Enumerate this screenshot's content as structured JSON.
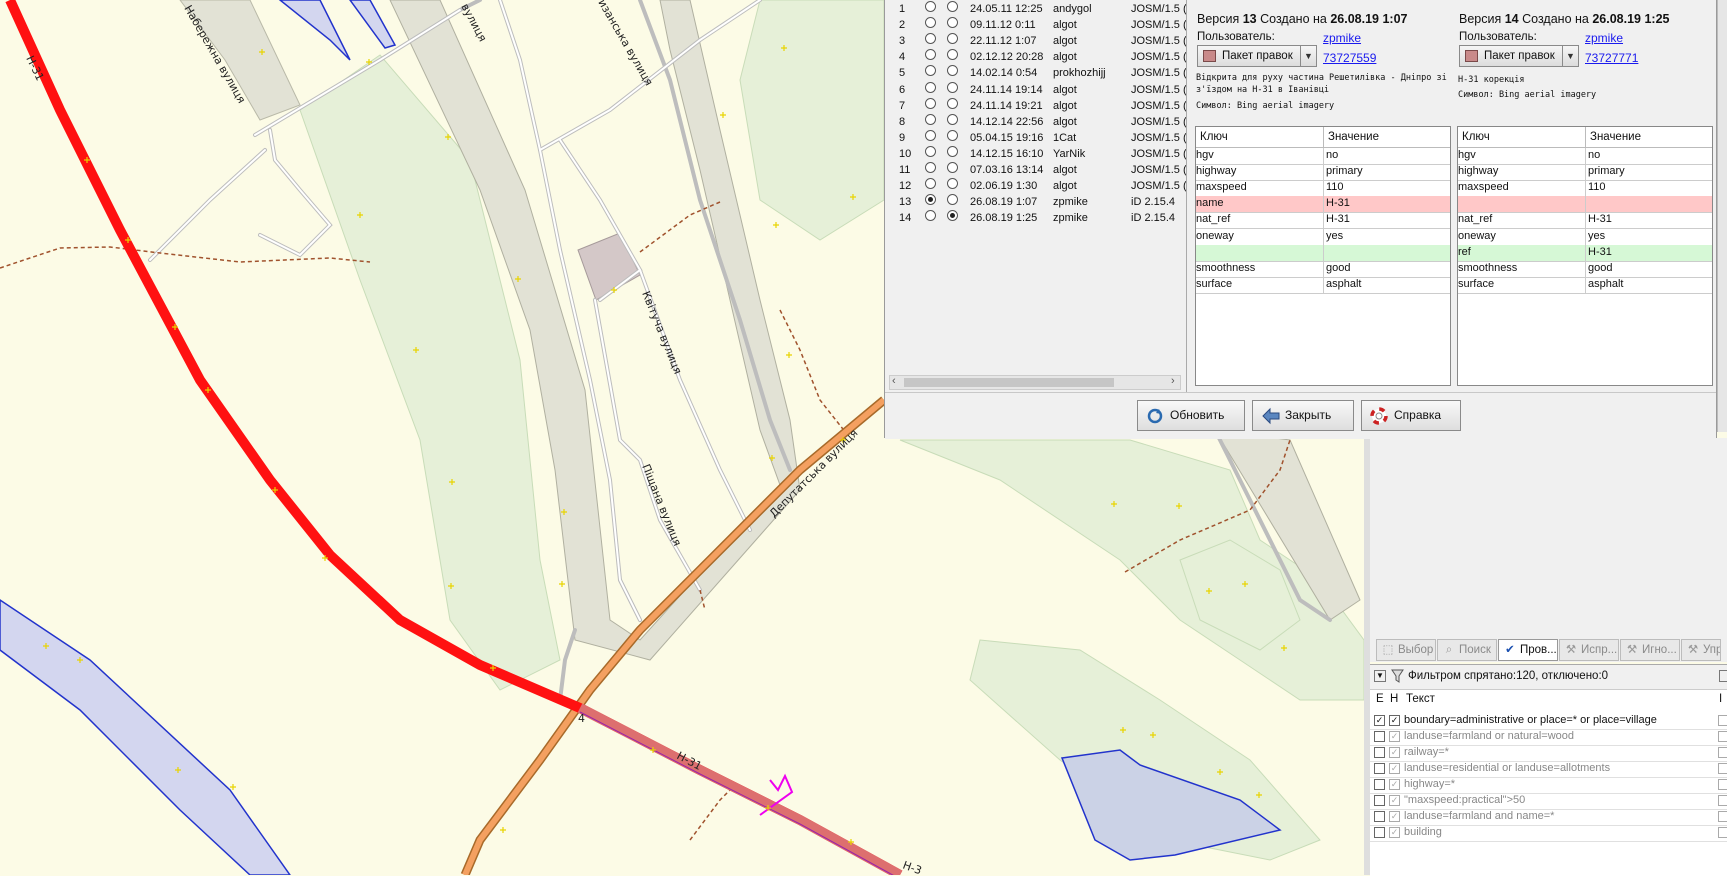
{
  "map": {
    "labels": {
      "street_embankment": "Набережна вулиця",
      "street_top": "вулиця",
      "street_vyzanska": "изанська вулиця",
      "street_kvitucha": "Квітуча вулиця",
      "street_pishchana": "Піщана вулиця",
      "street_deputatska": "Депутатська вулиця",
      "route_h31_a": "Н-31",
      "route_h31_b": "Н-31",
      "route_h31_c": "Н-3",
      "route_4": "4"
    }
  },
  "history": {
    "versions": [
      {
        "num": "1",
        "date": "24.05.11 12:25",
        "user": "andygol",
        "editor": "JOSM/1.5 (",
        "selA": false,
        "selB": false
      },
      {
        "num": "2",
        "date": "09.11.12 0:11",
        "user": "algot",
        "editor": "JOSM/1.5 (",
        "selA": false,
        "selB": false
      },
      {
        "num": "3",
        "date": "22.11.12 1:07",
        "user": "algot",
        "editor": "JOSM/1.5 (",
        "selA": false,
        "selB": false
      },
      {
        "num": "4",
        "date": "02.12.12 20:28",
        "user": "algot",
        "editor": "JOSM/1.5 (",
        "selA": false,
        "selB": false
      },
      {
        "num": "5",
        "date": "14.02.14 0:54",
        "user": "prokhozhijj",
        "editor": "JOSM/1.5 (",
        "selA": false,
        "selB": false
      },
      {
        "num": "6",
        "date": "24.11.14 19:14",
        "user": "algot",
        "editor": "JOSM/1.5 (",
        "selA": false,
        "selB": false
      },
      {
        "num": "7",
        "date": "24.11.14 19:21",
        "user": "algot",
        "editor": "JOSM/1.5 (",
        "selA": false,
        "selB": false
      },
      {
        "num": "8",
        "date": "14.12.14 22:56",
        "user": "algot",
        "editor": "JOSM/1.5 (",
        "selA": false,
        "selB": false
      },
      {
        "num": "9",
        "date": "05.04.15 19:16",
        "user": "1Cat",
        "editor": "JOSM/1.5 (",
        "selA": false,
        "selB": false
      },
      {
        "num": "10",
        "date": "14.12.15 16:10",
        "user": "YarNik",
        "editor": "JOSM/1.5 (",
        "selA": false,
        "selB": false
      },
      {
        "num": "11",
        "date": "07.03.16 13:14",
        "user": "algot",
        "editor": "JOSM/1.5 (",
        "selA": false,
        "selB": false
      },
      {
        "num": "12",
        "date": "02.06.19 1:30",
        "user": "algot",
        "editor": "JOSM/1.5 (",
        "selA": false,
        "selB": false
      },
      {
        "num": "13",
        "date": "26.08.19 1:07",
        "user": "zpmike",
        "editor": "iD 2.15.4",
        "selA": true,
        "selB": false
      },
      {
        "num": "14",
        "date": "26.08.19 1:25",
        "user": "zpmike",
        "editor": "iD 2.15.4",
        "selA": false,
        "selB": true
      }
    ],
    "left": {
      "title_prefix": "Версия",
      "version": "13",
      "created_label": "Создано на",
      "created": "26.08.19 1:07",
      "user_label": "Пользователь:",
      "user": "zpmike",
      "changeset_button": "Пакет правок",
      "changeset_id": "73727559",
      "comment": "Відкрита для руху частина Решетилівка - Дніпро зі з'їздом на Н-31 в Іванівці",
      "source": "Символ: Bing aerial imagery",
      "key_header": "Ключ",
      "value_header": "Значение",
      "tags": [
        {
          "key": "hgv",
          "value": "no",
          "state": ""
        },
        {
          "key": "highway",
          "value": "primary",
          "state": ""
        },
        {
          "key": "maxspeed",
          "value": "110",
          "state": ""
        },
        {
          "key": "name",
          "value": "Н-31",
          "state": "del"
        },
        {
          "key": "nat_ref",
          "value": "Н-31",
          "state": ""
        },
        {
          "key": "oneway",
          "value": "yes",
          "state": ""
        },
        {
          "key": "",
          "value": "",
          "state": "add"
        },
        {
          "key": "smoothness",
          "value": "good",
          "state": ""
        },
        {
          "key": "surface",
          "value": "asphalt",
          "state": ""
        }
      ]
    },
    "right": {
      "title_prefix": "Версия",
      "version": "14",
      "created_label": "Создано на",
      "created": "26.08.19 1:25",
      "user_label": "Пользователь:",
      "user": "zpmike",
      "changeset_button": "Пакет правок",
      "changeset_id": "73727771",
      "comment": "Н-31 корекція",
      "source": "Символ: Bing aerial imagery",
      "key_header": "Ключ",
      "value_header": "Значение",
      "tags": [
        {
          "key": "hgv",
          "value": "no",
          "state": ""
        },
        {
          "key": "highway",
          "value": "primary",
          "state": ""
        },
        {
          "key": "maxspeed",
          "value": "110",
          "state": ""
        },
        {
          "key": "",
          "value": "",
          "state": "del"
        },
        {
          "key": "nat_ref",
          "value": "Н-31",
          "state": ""
        },
        {
          "key": "oneway",
          "value": "yes",
          "state": ""
        },
        {
          "key": "ref",
          "value": "Н-31",
          "state": "add"
        },
        {
          "key": "smoothness",
          "value": "good",
          "state": ""
        },
        {
          "key": "surface",
          "value": "asphalt",
          "state": ""
        }
      ]
    },
    "buttons": {
      "refresh": "Обновить",
      "close": "Закрыть",
      "help": "Справка"
    }
  },
  "tabs": [
    {
      "label": "Выбор",
      "icon": "select-icon",
      "active": false
    },
    {
      "label": "Поиск",
      "icon": "search-icon",
      "active": false
    },
    {
      "label": "Пров...",
      "icon": "validation-check-icon",
      "active": true
    },
    {
      "label": "Испр...",
      "icon": "wrench-icon",
      "active": false
    },
    {
      "label": "Игно...",
      "icon": "wrench-icon",
      "active": false
    },
    {
      "label": "Упр",
      "icon": "wrench-icon",
      "active": false
    }
  ],
  "filter": {
    "status": "Фильтром спрятано:120, отключено:0",
    "col_e": "Е",
    "col_h": "Н",
    "col_text": "Текст",
    "col_i": "I",
    "rows": [
      {
        "text": "boundary=administrative or place=* or place=village",
        "e": true,
        "h": true,
        "enabled": true
      },
      {
        "text": "landuse=farmland or natural=wood",
        "e": false,
        "h": true,
        "enabled": false
      },
      {
        "text": "railway=*",
        "e": false,
        "h": true,
        "enabled": false
      },
      {
        "text": "landuse=residential or landuse=allotments",
        "e": false,
        "h": true,
        "enabled": false
      },
      {
        "text": "highway=*",
        "e": false,
        "h": true,
        "enabled": false
      },
      {
        "text": "\"maxspeed:practical\">50",
        "e": false,
        "h": true,
        "enabled": false
      },
      {
        "text": "landuse=farmland and name=*",
        "e": false,
        "h": true,
        "enabled": false
      },
      {
        "text": "building",
        "e": false,
        "h": true,
        "enabled": false
      }
    ]
  },
  "colors": {
    "map_background": "#fcfbe6",
    "forest": "#e6f0d8",
    "residential": "#e2e2d5",
    "water": "#d3d6ef",
    "route_red": "#ff1111",
    "route_primary": "#f4a060",
    "diff_removed": "#ffc8c8",
    "diff_added": "#d6f8d6",
    "link": "#1a1aee"
  }
}
